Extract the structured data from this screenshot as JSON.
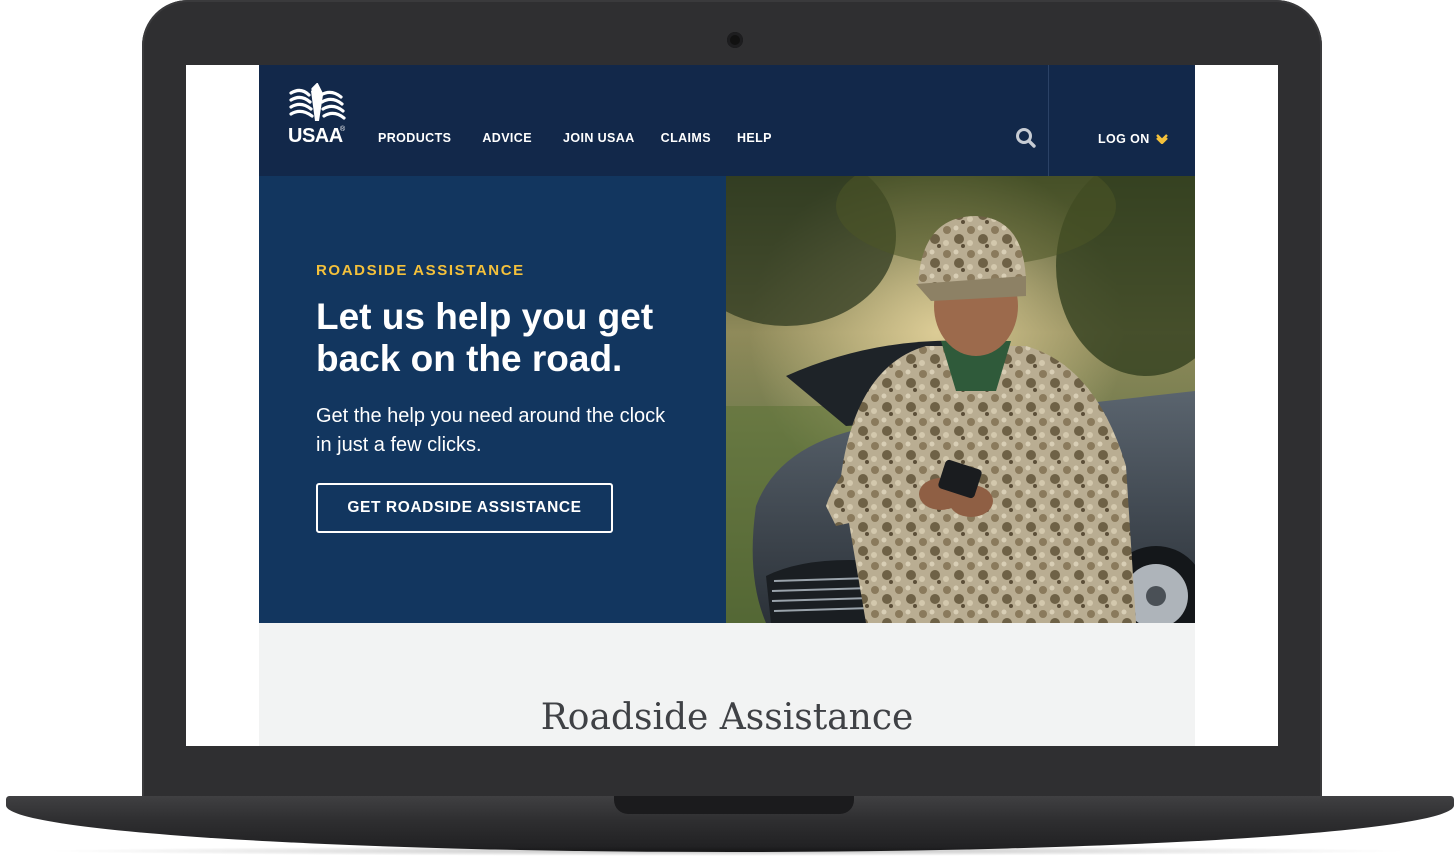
{
  "brand": {
    "name": "USAA",
    "reg_mark": "®"
  },
  "nav": {
    "items": [
      {
        "label": "PRODUCTS"
      },
      {
        "label": "ADVICE"
      },
      {
        "label": "JOIN USAA"
      },
      {
        "label": "CLAIMS"
      },
      {
        "label": "HELP"
      }
    ],
    "search_icon": "search-icon",
    "logon_label": "LOG ON",
    "logon_icon": "chevron-down-icon"
  },
  "hero": {
    "eyebrow": "ROADSIDE ASSISTANCE",
    "headline": "Let us help you get back on the road.",
    "subcopy": "Get the help you need around the clock in just a few clicks.",
    "cta_label": "GET ROADSIDE ASSISTANCE",
    "photo": "soldier-with-phone-beside-car"
  },
  "section": {
    "title": "Roadside Assistance"
  },
  "colors": {
    "header_bg": "#12284a",
    "hero_bg": "#12365f",
    "accent_gold": "#f4c13b",
    "page_bg": "#f2f3f3",
    "device_frame": "#2f2f31"
  }
}
